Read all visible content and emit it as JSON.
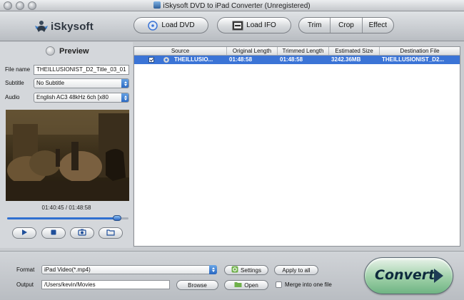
{
  "window": {
    "title": "iSkysoft DVD to iPad Converter (Unregistered)"
  },
  "toolbar": {
    "logo_text": "iSkysoft",
    "load_dvd": "Load DVD",
    "load_ifo": "Load IFO",
    "trim": "Trim",
    "crop": "Crop",
    "effect": "Effect"
  },
  "preview": {
    "heading": "Preview",
    "file_name_label": "File name",
    "file_name_value": "THEILLUSIONIST_D2_Title_03_01",
    "subtitle_label": "Subtitle",
    "subtitle_value": "No Subtitle",
    "audio_label": "Audio",
    "audio_value": "English AC3 48kHz 6ch [x80",
    "timecode": "01:40:45 / 01:48:58",
    "progress": 0.905
  },
  "table": {
    "headers": [
      "Source",
      "Original Length",
      "Trimmed Length",
      "Estimated Size",
      "Destination File"
    ],
    "rows": [
      {
        "checked": true,
        "source": "THEILLUSIO...",
        "original_length": "01:48:58",
        "trimmed_length": "01:48:58",
        "estimated_size": "3242.36MB",
        "destination_file": "THEILLUSIONIST_D2..."
      }
    ]
  },
  "output": {
    "format_label": "Format",
    "format_value": "iPad Video(*.mp4)",
    "output_label": "Output",
    "output_value": "/Users/kevin/Movies",
    "settings": "Settings",
    "apply_all": "Apply to all",
    "browse": "Browse",
    "open": "Open",
    "merge_label": "Merge into one file",
    "merge_checked": false,
    "convert": "Convert"
  },
  "colors": {
    "selection": "#3b74d6",
    "accent_blue": "#2766c1",
    "convert_green": "#9ed0a8"
  }
}
